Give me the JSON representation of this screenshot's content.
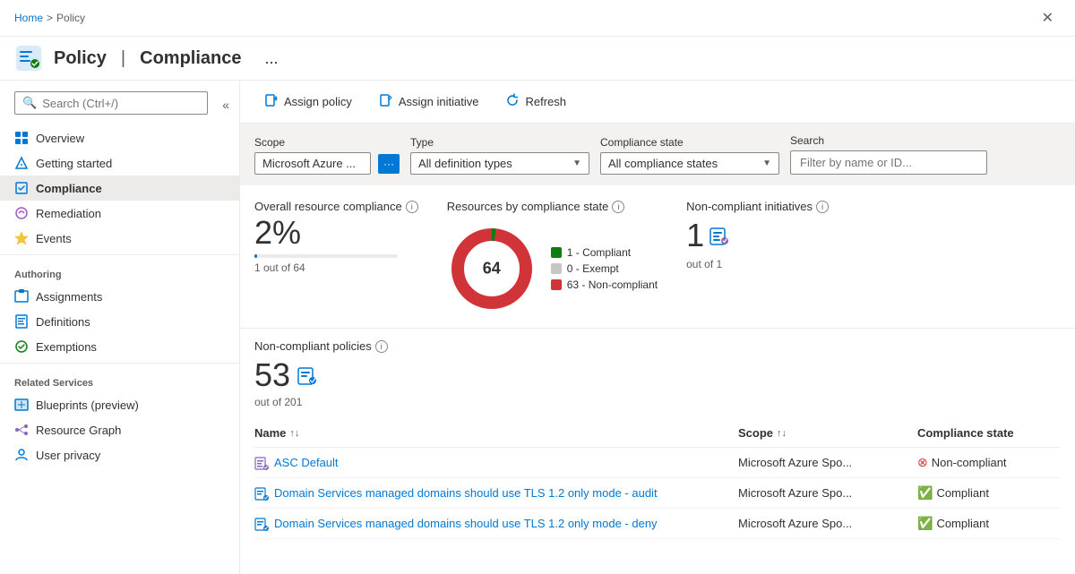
{
  "breadcrumb": {
    "home": "Home",
    "separator": ">",
    "current": "Policy"
  },
  "header": {
    "title": "Policy",
    "separator": "|",
    "subtitle": "Compliance",
    "ellipsis": "..."
  },
  "sidebar": {
    "search_placeholder": "Search (Ctrl+/)",
    "nav_items": [
      {
        "id": "overview",
        "label": "Overview",
        "icon": "🏠",
        "active": false
      },
      {
        "id": "getting-started",
        "label": "Getting started",
        "icon": "🚀",
        "active": false
      },
      {
        "id": "compliance",
        "label": "Compliance",
        "icon": "📋",
        "active": true
      }
    ],
    "remediation": {
      "id": "remediation",
      "label": "Remediation",
      "icon": "🔧"
    },
    "events": {
      "id": "events",
      "label": "Events",
      "icon": "⚡"
    },
    "authoring_label": "Authoring",
    "authoring_items": [
      {
        "id": "assignments",
        "label": "Assignments",
        "icon": "📌"
      },
      {
        "id": "definitions",
        "label": "Definitions",
        "icon": "📄"
      },
      {
        "id": "exemptions",
        "label": "Exemptions",
        "icon": "🔓"
      }
    ],
    "related_label": "Related Services",
    "related_items": [
      {
        "id": "blueprints",
        "label": "Blueprints (preview)",
        "icon": "🔵"
      },
      {
        "id": "resource-graph",
        "label": "Resource Graph",
        "icon": "🌐"
      },
      {
        "id": "user-privacy",
        "label": "User privacy",
        "icon": "👤"
      }
    ]
  },
  "toolbar": {
    "assign_policy": "Assign policy",
    "assign_initiative": "Assign initiative",
    "refresh": "Refresh"
  },
  "filters": {
    "scope_label": "Scope",
    "scope_value": "Microsoft Azure ...",
    "type_label": "Type",
    "type_value": "All definition types",
    "compliance_label": "Compliance state",
    "compliance_value": "All compliance states",
    "search_label": "Search",
    "search_placeholder": "Filter by name or ID..."
  },
  "stats": {
    "overall_title": "Overall resource compliance",
    "overall_percent": "2%",
    "overall_sub": "1 out of 64",
    "progress_percent": 2,
    "donut_title": "Resources by compliance state",
    "donut_center": "64",
    "donut_compliant": 1,
    "donut_exempt": 0,
    "donut_non_compliant": 63,
    "legend": [
      {
        "label": "1 - Compliant",
        "color": "#107c10"
      },
      {
        "label": "0 - Exempt",
        "color": "#c8c6c4"
      },
      {
        "label": "63 - Non-compliant",
        "color": "#d13438"
      }
    ],
    "initiatives_title": "Non-compliant initiatives",
    "initiatives_value": "1",
    "initiatives_sub": "out of 1"
  },
  "policies": {
    "title": "Non-compliant policies",
    "value": "53",
    "sub": "out of 201"
  },
  "table": {
    "col_name": "Name",
    "col_scope": "Scope",
    "col_state": "Compliance state",
    "rows": [
      {
        "name": "ASC Default",
        "type": "initiative",
        "scope": "Microsoft Azure Spo...",
        "state": "Non-compliant",
        "compliant": false
      },
      {
        "name": "Domain Services managed domains should use TLS 1.2 only mode - audit",
        "type": "policy",
        "scope": "Microsoft Azure Spo...",
        "state": "Compliant",
        "compliant": true
      },
      {
        "name": "Domain Services managed domains should use TLS 1.2 only mode - deny",
        "type": "policy",
        "scope": "Microsoft Azure Spo...",
        "state": "Compliant",
        "compliant": true
      }
    ]
  }
}
